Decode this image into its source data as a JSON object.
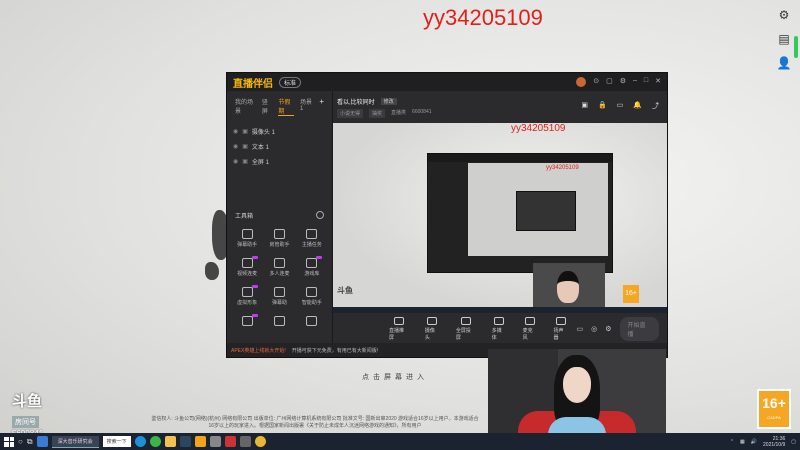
{
  "overlay_id": "yy34205109",
  "app": {
    "brand_left": "直播伴侣",
    "brand_right": "",
    "mode_pill": "标准",
    "scene_tabs": [
      "我的场景",
      "竖屏",
      "节假期",
      "场景1"
    ],
    "active_tab_index": 2,
    "sources": [
      {
        "label": "摄像头 1"
      },
      {
        "label": "文本 1"
      },
      {
        "label": "全屏 1"
      }
    ],
    "toolbox_title": "工具箱",
    "tools": [
      "弹幕助手",
      "房管助手",
      "主播任务",
      "视频连麦",
      "多人连麦",
      "游戏库",
      "虚拟形象",
      "弹幕助",
      "智能助手",
      "",
      "",
      ""
    ],
    "room_name": "看以,比较同时",
    "room_badge": "修改",
    "room_chips": [
      "小说无得",
      "抽奖"
    ],
    "room_meta": [
      "直播类",
      "6600841"
    ],
    "preview_id": "yy34205109",
    "inner_preview_id": "yy34205109",
    "inner_logo": "斗鱼",
    "inner_age": "16+",
    "controls": [
      "直播推屏",
      "摄像头",
      "全屏投屏",
      "多媒体",
      "麦克风",
      "扬声器"
    ],
    "live_button": "开始直播",
    "status_warning": "APEX英雄上线就大开始!",
    "status_text": "开播可获下元免费，有用已有大新闻版!"
  },
  "desktop": {
    "tap_hint": "点击屏幕进入",
    "legal": "鉴信权人: 斗鱼公司(网络)(杭州) 网络有限公司 出版单位: 广州网络计算机系统有限公司 批准文号: 国新出审2020 游戏适合16岁以上用户。本游戏适合16岁以上的玩家进入。根据国家新闻出版署《关于防止未成年人沉迷网络游戏的通知》，所有用户"
  },
  "douyu": {
    "logo": "斗鱼",
    "room_label": "房间号",
    "room_number": "5600841"
  },
  "age_badge": {
    "number": "16+",
    "sub": "CADPA"
  },
  "taskbar": {
    "active_task": "深大音乐研究会",
    "search": "搜索一下",
    "time": "21:36",
    "date": "2021/10/9"
  },
  "colors": {
    "brand_orange": "#f3a21c",
    "overlay_red": "#e0201c",
    "age_orange": "#f5a623"
  }
}
